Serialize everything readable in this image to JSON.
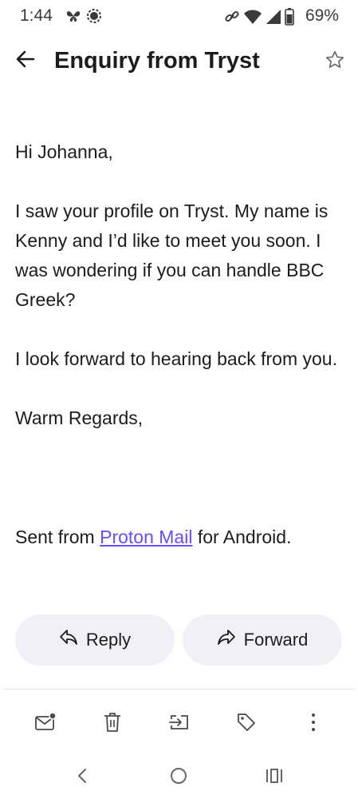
{
  "status_bar": {
    "time": "1:44",
    "battery": "69%",
    "icons": [
      "butterfly-icon",
      "signal-app-icon",
      "link-icon",
      "wifi-icon",
      "cell-signal-icon",
      "battery-icon"
    ]
  },
  "header": {
    "title": "Enquiry from Tryst",
    "back_icon": "arrow-left-icon",
    "star_icon": "star-outline-icon"
  },
  "message": {
    "greeting": "Hi Johanna,",
    "paragraph1": "I saw your profile on Tryst. My name is Kenny and I’d like to meet you soon. I was wondering if you can handle BBC Greek?",
    "paragraph2": "I look forward to hearing back from you.",
    "closing": "Warm Regards,",
    "signature_prefix": "Sent from ",
    "signature_link": "Proton Mail",
    "signature_suffix": " for Android."
  },
  "actions": {
    "reply_label": "Reply",
    "forward_label": "Forward"
  },
  "bottom_bar": {
    "icons": [
      "mark-unread-icon",
      "trash-icon",
      "move-to-folder-icon",
      "label-icon",
      "more-vertical-icon"
    ]
  },
  "nav_bar": {
    "icons": [
      "nav-back-icon",
      "nav-home-icon",
      "nav-recents-icon"
    ]
  },
  "colors": {
    "accent": "#6d4aff",
    "button_bg": "#f0f1f6",
    "text": "#1c1c1c"
  }
}
